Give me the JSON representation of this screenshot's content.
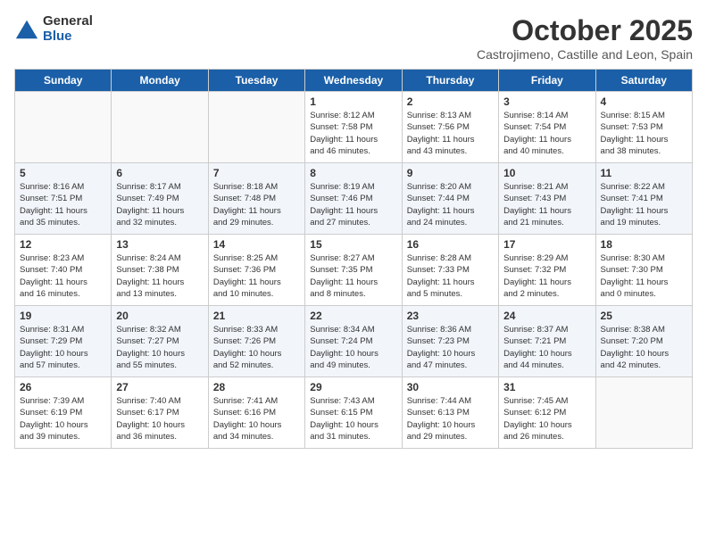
{
  "logo": {
    "general": "General",
    "blue": "Blue",
    "icon": "▶"
  },
  "title": "October 2025",
  "location": "Castrojimeno, Castille and Leon, Spain",
  "weekdays": [
    "Sunday",
    "Monday",
    "Tuesday",
    "Wednesday",
    "Thursday",
    "Friday",
    "Saturday"
  ],
  "weeks": [
    [
      {
        "day": "",
        "info": ""
      },
      {
        "day": "",
        "info": ""
      },
      {
        "day": "",
        "info": ""
      },
      {
        "day": "1",
        "info": "Sunrise: 8:12 AM\nSunset: 7:58 PM\nDaylight: 11 hours\nand 46 minutes."
      },
      {
        "day": "2",
        "info": "Sunrise: 8:13 AM\nSunset: 7:56 PM\nDaylight: 11 hours\nand 43 minutes."
      },
      {
        "day": "3",
        "info": "Sunrise: 8:14 AM\nSunset: 7:54 PM\nDaylight: 11 hours\nand 40 minutes."
      },
      {
        "day": "4",
        "info": "Sunrise: 8:15 AM\nSunset: 7:53 PM\nDaylight: 11 hours\nand 38 minutes."
      }
    ],
    [
      {
        "day": "5",
        "info": "Sunrise: 8:16 AM\nSunset: 7:51 PM\nDaylight: 11 hours\nand 35 minutes."
      },
      {
        "day": "6",
        "info": "Sunrise: 8:17 AM\nSunset: 7:49 PM\nDaylight: 11 hours\nand 32 minutes."
      },
      {
        "day": "7",
        "info": "Sunrise: 8:18 AM\nSunset: 7:48 PM\nDaylight: 11 hours\nand 29 minutes."
      },
      {
        "day": "8",
        "info": "Sunrise: 8:19 AM\nSunset: 7:46 PM\nDaylight: 11 hours\nand 27 minutes."
      },
      {
        "day": "9",
        "info": "Sunrise: 8:20 AM\nSunset: 7:44 PM\nDaylight: 11 hours\nand 24 minutes."
      },
      {
        "day": "10",
        "info": "Sunrise: 8:21 AM\nSunset: 7:43 PM\nDaylight: 11 hours\nand 21 minutes."
      },
      {
        "day": "11",
        "info": "Sunrise: 8:22 AM\nSunset: 7:41 PM\nDaylight: 11 hours\nand 19 minutes."
      }
    ],
    [
      {
        "day": "12",
        "info": "Sunrise: 8:23 AM\nSunset: 7:40 PM\nDaylight: 11 hours\nand 16 minutes."
      },
      {
        "day": "13",
        "info": "Sunrise: 8:24 AM\nSunset: 7:38 PM\nDaylight: 11 hours\nand 13 minutes."
      },
      {
        "day": "14",
        "info": "Sunrise: 8:25 AM\nSunset: 7:36 PM\nDaylight: 11 hours\nand 10 minutes."
      },
      {
        "day": "15",
        "info": "Sunrise: 8:27 AM\nSunset: 7:35 PM\nDaylight: 11 hours\nand 8 minutes."
      },
      {
        "day": "16",
        "info": "Sunrise: 8:28 AM\nSunset: 7:33 PM\nDaylight: 11 hours\nand 5 minutes."
      },
      {
        "day": "17",
        "info": "Sunrise: 8:29 AM\nSunset: 7:32 PM\nDaylight: 11 hours\nand 2 minutes."
      },
      {
        "day": "18",
        "info": "Sunrise: 8:30 AM\nSunset: 7:30 PM\nDaylight: 11 hours\nand 0 minutes."
      }
    ],
    [
      {
        "day": "19",
        "info": "Sunrise: 8:31 AM\nSunset: 7:29 PM\nDaylight: 10 hours\nand 57 minutes."
      },
      {
        "day": "20",
        "info": "Sunrise: 8:32 AM\nSunset: 7:27 PM\nDaylight: 10 hours\nand 55 minutes."
      },
      {
        "day": "21",
        "info": "Sunrise: 8:33 AM\nSunset: 7:26 PM\nDaylight: 10 hours\nand 52 minutes."
      },
      {
        "day": "22",
        "info": "Sunrise: 8:34 AM\nSunset: 7:24 PM\nDaylight: 10 hours\nand 49 minutes."
      },
      {
        "day": "23",
        "info": "Sunrise: 8:36 AM\nSunset: 7:23 PM\nDaylight: 10 hours\nand 47 minutes."
      },
      {
        "day": "24",
        "info": "Sunrise: 8:37 AM\nSunset: 7:21 PM\nDaylight: 10 hours\nand 44 minutes."
      },
      {
        "day": "25",
        "info": "Sunrise: 8:38 AM\nSunset: 7:20 PM\nDaylight: 10 hours\nand 42 minutes."
      }
    ],
    [
      {
        "day": "26",
        "info": "Sunrise: 7:39 AM\nSunset: 6:19 PM\nDaylight: 10 hours\nand 39 minutes."
      },
      {
        "day": "27",
        "info": "Sunrise: 7:40 AM\nSunset: 6:17 PM\nDaylight: 10 hours\nand 36 minutes."
      },
      {
        "day": "28",
        "info": "Sunrise: 7:41 AM\nSunset: 6:16 PM\nDaylight: 10 hours\nand 34 minutes."
      },
      {
        "day": "29",
        "info": "Sunrise: 7:43 AM\nSunset: 6:15 PM\nDaylight: 10 hours\nand 31 minutes."
      },
      {
        "day": "30",
        "info": "Sunrise: 7:44 AM\nSunset: 6:13 PM\nDaylight: 10 hours\nand 29 minutes."
      },
      {
        "day": "31",
        "info": "Sunrise: 7:45 AM\nSunset: 6:12 PM\nDaylight: 10 hours\nand 26 minutes."
      },
      {
        "day": "",
        "info": ""
      }
    ]
  ]
}
